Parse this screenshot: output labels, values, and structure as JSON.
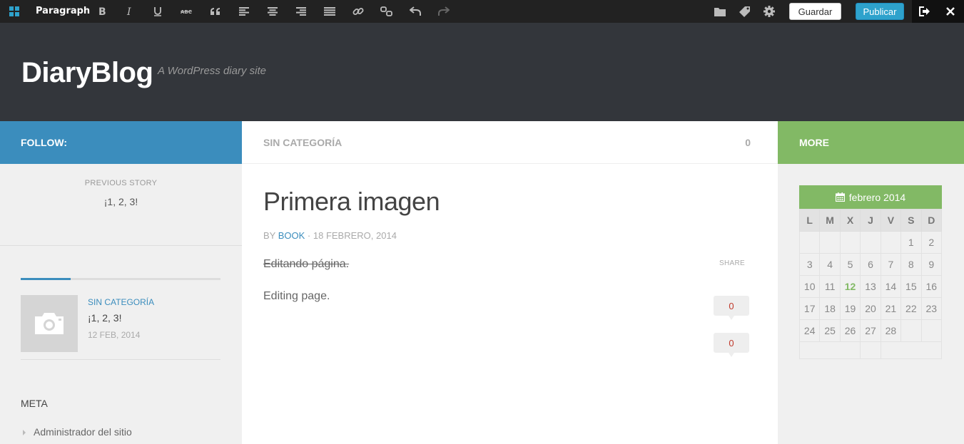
{
  "toolbar": {
    "format_label": "Paragraph",
    "save_label": "Guardar",
    "publish_label": "Publicar"
  },
  "header": {
    "site_title": "DiaryBlog",
    "site_description": "A WordPress diary site"
  },
  "left_sidebar": {
    "follow_label": "FOLLOW:",
    "previous_story_label": "PREVIOUS STORY",
    "previous_story_title": "¡1, 2, 3!",
    "post": {
      "category": "SIN CATEGORÍA",
      "title": "¡1, 2, 3!",
      "date": "12 FEB, 2014"
    },
    "meta_title": "META",
    "meta_items": [
      "Administrador del sitio"
    ]
  },
  "main": {
    "category": "SIN CATEGORÍA",
    "comment_count": "0",
    "entry_title": "Primera imagen",
    "byline_prefix": "BY",
    "author": "BOOK",
    "byline_sep": " · ",
    "date": "18 FEBRERO, 2014",
    "strike_text": "Editando página.",
    "share_label": "SHARE",
    "body_text": "Editing page.",
    "share_counts": [
      "0",
      "0"
    ]
  },
  "right_sidebar": {
    "more_label": "MORE",
    "calendar": {
      "month": "febrero 2014",
      "weekdays": [
        "L",
        "M",
        "X",
        "J",
        "V",
        "S",
        "D"
      ],
      "weeks": [
        [
          "",
          "",
          "",
          "",
          "",
          "1",
          "2"
        ],
        [
          "3",
          "4",
          "5",
          "6",
          "7",
          "8",
          "9"
        ],
        [
          "10",
          "11",
          "12",
          "13",
          "14",
          "15",
          "16"
        ],
        [
          "17",
          "18",
          "19",
          "20",
          "21",
          "22",
          "23"
        ],
        [
          "24",
          "25",
          "26",
          "27",
          "28",
          "",
          ""
        ]
      ],
      "today": "12"
    }
  },
  "colors": {
    "blue": "#3b8dbd",
    "green": "#82b965",
    "header_bg": "#33363b",
    "toolbar_bg": "#222222"
  },
  "icons": [
    "grid-icon",
    "bold-icon",
    "italic-icon",
    "underline-icon",
    "strikethrough-icon",
    "blockquote-icon",
    "align-left-icon",
    "align-center-icon",
    "align-right-icon",
    "justify-icon",
    "link-icon",
    "unlink-icon",
    "undo-icon",
    "redo-icon",
    "folder-icon",
    "tag-icon",
    "gear-icon",
    "exit-icon",
    "close-icon",
    "calendar-icon",
    "camera-icon"
  ]
}
